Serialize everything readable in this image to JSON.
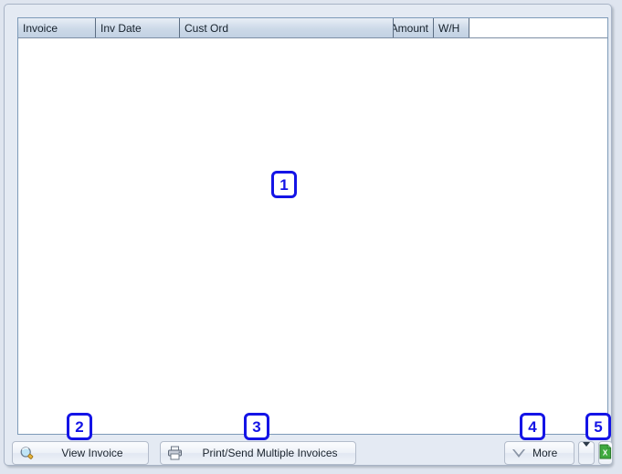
{
  "window": {
    "background_color": "#dfe5ef",
    "panel_color": "#e4eaf3",
    "border_color": "#a8b4c6"
  },
  "grid": {
    "name": "invoice-list-grid",
    "columns": [
      {
        "id": "invoice",
        "label": "Invoice",
        "align": "left"
      },
      {
        "id": "inv_date",
        "label": "Inv Date",
        "align": "left"
      },
      {
        "id": "cust_ord",
        "label": "Cust Ord",
        "align": "left"
      },
      {
        "id": "amount",
        "label": "Amount",
        "align": "right"
      },
      {
        "id": "wh",
        "label": "W/H",
        "align": "left"
      }
    ],
    "rows": [],
    "empty": true
  },
  "toolbar": {
    "view_invoice_label": "View Invoice",
    "view_invoice_icon": "magnifier-icon",
    "print_send_label": "Print/Send Multiple Invoices",
    "print_send_icon": "printer-icon",
    "more_label": "More",
    "more_icon": "caret-down-outline-icon",
    "more_arrow_icon": "chevron-down-icon",
    "export_excel_icon": "excel-export-icon"
  },
  "annotations": {
    "accent_color": "#1414e6",
    "badges": [
      {
        "id": "badge-1",
        "number": "1",
        "target": "invoice-list-grid"
      },
      {
        "id": "badge-2",
        "number": "2",
        "target": "view-invoice-button"
      },
      {
        "id": "badge-3",
        "number": "3",
        "target": "print-send-multiple-invoices-button"
      },
      {
        "id": "badge-4",
        "number": "4",
        "target": "more-button"
      },
      {
        "id": "badge-5",
        "number": "5",
        "target": "export-excel-button"
      }
    ]
  }
}
